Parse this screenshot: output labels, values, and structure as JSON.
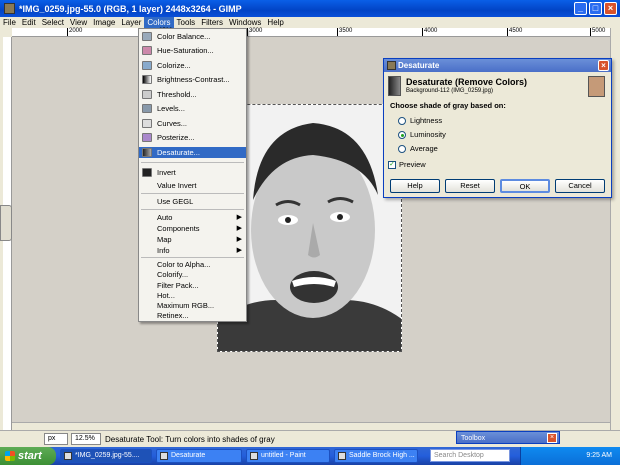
{
  "window": {
    "title": "*IMG_0259.jpg-55.0 (RGB, 1 layer) 2448x3264 - GIMP"
  },
  "menubar": [
    "File",
    "Edit",
    "Select",
    "View",
    "Image",
    "Layer",
    "Colors",
    "Tools",
    "Filters",
    "Windows",
    "Help"
  ],
  "ruler": {
    "ticks": [
      "2000",
      "2500",
      "3000",
      "3500",
      "4000",
      "4500",
      "5000"
    ]
  },
  "colors_menu": {
    "group1": [
      "Color Balance...",
      "Hue-Saturation...",
      "Colorize...",
      "Brightness-Contrast...",
      "Threshold...",
      "Levels...",
      "Curves...",
      "Posterize...",
      "Desaturate..."
    ],
    "group2": [
      "Invert",
      "Value Invert"
    ],
    "group3": [
      "Use GEGL"
    ],
    "group4": [
      "Auto",
      "Components",
      "Map",
      "Info"
    ],
    "group5": [
      "Color to Alpha...",
      "Colorify...",
      "Filter Pack...",
      "Hot...",
      "Maximum RGB...",
      "Retinex..."
    ],
    "highlighted": "Desaturate..."
  },
  "dialog": {
    "title": "Desaturate",
    "heading": "Desaturate (Remove Colors)",
    "subheading": "Background-112 (IMG_0259.jpg)",
    "prompt": "Choose shade of gray based on:",
    "options": [
      "Lightness",
      "Luminosity",
      "Average"
    ],
    "selected": "Luminosity",
    "preview_label": "Preview",
    "buttons": {
      "help": "Help",
      "reset": "Reset",
      "ok": "OK",
      "cancel": "Cancel"
    }
  },
  "statusbar": {
    "unit": "px",
    "zoom": "12.5%",
    "message": "Desaturate Tool: Turn colors into shades of gray"
  },
  "toolbox": {
    "title": "Toolbox"
  },
  "taskbar": {
    "start": "start",
    "tasks": [
      "*IMG_0259.jpg-55....",
      "Desaturate",
      "untitled - Paint",
      "Saddle Brock High ...",
      "Mozilla Firefox"
    ],
    "search_placeholder": "Search Desktop",
    "clock": "9:25 AM"
  }
}
